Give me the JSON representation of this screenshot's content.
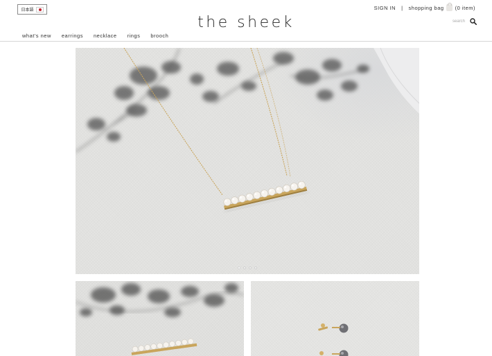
{
  "header": {
    "language_label": "日本語",
    "sign_in_label": "SIGN IN",
    "separator": "|",
    "bag_label": "shopping bag",
    "bag_count": "(0 item)",
    "logo": "the sheek",
    "search_placeholder": "search"
  },
  "nav": {
    "items": [
      {
        "label": "what's new"
      },
      {
        "label": "earrings"
      },
      {
        "label": "necklace"
      },
      {
        "label": "rings"
      },
      {
        "label": "brooch"
      }
    ]
  },
  "hero": {
    "image": "pearl-bar-necklace-photo",
    "slide_count": 4,
    "active_slide": 1
  },
  "thumbnails": [
    {
      "image": "pearl-bar-brooch-photo"
    },
    {
      "image": "grey-pearl-stud-earrings-photo"
    }
  ],
  "colors": {
    "text": "#333333",
    "gold": "#c9a55c",
    "pearl": "#f6f3ee",
    "shadow": "#4a4a4a"
  },
  "icons": [
    "japan-flag-icon",
    "shopping-bag-icon",
    "search-icon"
  ]
}
